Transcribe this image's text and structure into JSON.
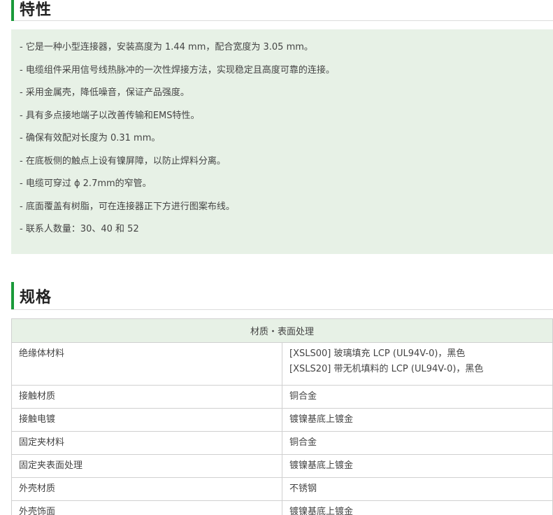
{
  "features": {
    "heading": "特性",
    "items": [
      "- 它是一种小型连接器，安装高度为 1.44 mm，配合宽度为 3.05 mm。",
      "- 电缆组件采用信号线热脉冲的一次性焊接方法，实现稳定且高度可靠的连接。",
      "- 采用金属壳，降低噪音，保证产品强度。",
      "- 具有多点接地端子以改善传输和EMS特性。",
      "- 确保有效配对长度为 0.31 mm。",
      "- 在底板侧的触点上设有镍屏障，以防止焊料分离。",
      "- 电缆可穿过 ϕ 2.7mm的窄管。",
      "- 底面覆盖有树脂，可在连接器正下方进行图案布线。",
      "- 联系人数量：30、40 和 52"
    ]
  },
  "specs": {
    "heading": "规格",
    "table_header": "材质・表面处理",
    "rows": [
      {
        "label": "绝缘体材料",
        "values": [
          "[XSLS00] 玻璃填充 LCP (UL94V-0)，黑色",
          "[XSLS20] 带无机填料的 LCP (UL94V-0)，黑色"
        ]
      },
      {
        "label": "接触材质",
        "values": [
          "铜合金"
        ]
      },
      {
        "label": "接触电镀",
        "values": [
          "镀镍基底上镀金"
        ]
      },
      {
        "label": "固定夹材料",
        "values": [
          "铜合金"
        ]
      },
      {
        "label": "固定夹表面处理",
        "values": [
          "镀镍基底上镀金"
        ]
      },
      {
        "label": "外壳材质",
        "values": [
          "不锈钢"
        ]
      },
      {
        "label": "外壳饰面",
        "values": [
          "镀镍基底上镀金"
        ]
      }
    ]
  }
}
